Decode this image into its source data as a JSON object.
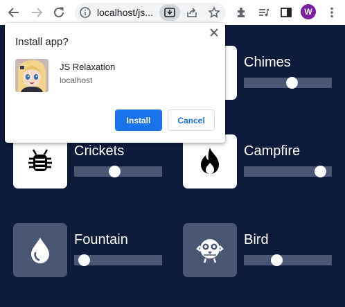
{
  "browser": {
    "url": "localhost/js...",
    "profile_initial": "W",
    "colors": {
      "toolbar": "#ffffff",
      "omnibox": "#f1f3f4",
      "avatar": "#7b1fa2"
    },
    "icons": [
      "back-arrow-icon",
      "forward-arrow-icon",
      "reload-icon",
      "info-icon",
      "install-app-icon",
      "share-icon",
      "star-icon",
      "extensions-icon",
      "media-queue-icon",
      "side-panel-icon",
      "menu-icon"
    ]
  },
  "popup": {
    "title": "Install app?",
    "app_name": "JS Relaxation",
    "app_host": "localhost",
    "install_label": "Install",
    "cancel_label": "Cancel"
  },
  "sounds": [
    {
      "name": "Chimes",
      "icon": "chimes-icon",
      "tile": "white",
      "volume": 0.55
    },
    {
      "name": "Crickets",
      "icon": "cricket-icon",
      "tile": "white",
      "volume": 0.45
    },
    {
      "name": "Campfire",
      "icon": "fire-icon",
      "tile": "white",
      "volume": 0.93
    },
    {
      "name": "Fountain",
      "icon": "water-drop-icon",
      "tile": "dark",
      "volume": 0.05
    },
    {
      "name": "Bird",
      "icon": "bird-icon",
      "tile": "dark",
      "volume": 0.35
    }
  ],
  "colors": {
    "page_bg": "#0f1b3a",
    "tile_dark": "#4a5672",
    "slider_track": "#4a5672",
    "primary": "#1a73e8"
  }
}
